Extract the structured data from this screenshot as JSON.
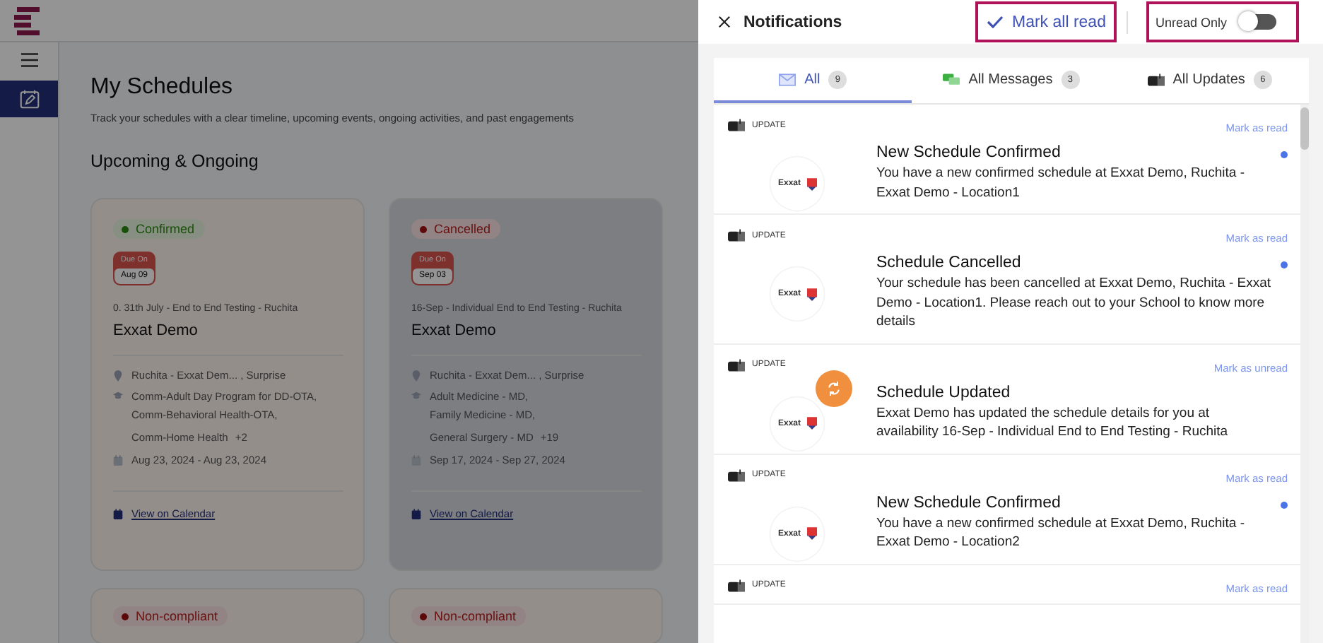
{
  "page": {
    "title": "My Schedules",
    "subtitle": "Track your schedules with a clear timeline, upcoming events, ongoing activities, and past engagements",
    "section": "Upcoming & Ongoing"
  },
  "cards": [
    {
      "status": {
        "label": "Confirmed",
        "kind": "confirmed"
      },
      "highlighted": false,
      "due_label": "Due On",
      "due_date": "Aug 09",
      "subtitle": "0. 31th July - End to End Testing - Ruchita",
      "title": "Exxat Demo",
      "location": "Ruchita - Exxat Dem...  , Surprise",
      "programs": [
        "Comm-Adult Day Program for DD-OTA,",
        "Comm-Behavioral Health-OTA,",
        "Comm-Home Health"
      ],
      "more": "+2",
      "dates": "Aug 23, 2024 - Aug 23, 2024",
      "link": "View on Calendar"
    },
    {
      "status": {
        "label": "Cancelled",
        "kind": "cancelled"
      },
      "highlighted": true,
      "due_label": "Due On",
      "due_date": "Sep 03",
      "subtitle": "16-Sep - Individual End to End Testing - Ruchita",
      "title": "Exxat Demo",
      "location": "Ruchita - Exxat Dem...  , Surprise",
      "programs": [
        "Adult Medicine - MD,",
        "Family Medicine - MD,",
        "General Surgery - MD"
      ],
      "more": "+19",
      "dates": "Sep 17, 2024 - Sep 27, 2024",
      "link": "View on Calendar"
    }
  ],
  "next_cards": [
    {
      "status": {
        "label": "Non-compliant",
        "kind": "noncompliant"
      }
    },
    {
      "status": {
        "label": "Non-compliant",
        "kind": "noncompliant"
      }
    }
  ],
  "panel": {
    "title": "Notifications",
    "mark_all": "Mark all read",
    "unread_only": {
      "label": "Unread Only",
      "on": false
    }
  },
  "tabs": [
    {
      "label": "All",
      "count": "9",
      "kind": "mail",
      "selected": true
    },
    {
      "label": "All Messages",
      "count": "3",
      "kind": "chat",
      "selected": false
    },
    {
      "label": "All Updates",
      "count": "6",
      "kind": "update",
      "selected": false
    }
  ],
  "notifications": [
    {
      "type": "UPDATE",
      "action": "Mark as read",
      "title": "New Schedule Confirmed",
      "body": "You have a new confirmed schedule at Exxat Demo, Ruchita - Exxat Demo - Location1",
      "logo": "Exxat",
      "unread": true,
      "badge": false
    },
    {
      "type": "UPDATE",
      "action": "Mark as read",
      "title": "Schedule Cancelled",
      "body": "Your schedule has been cancelled at Exxat Demo, Ruchita - Exxat Demo - Location1. Please reach out to your School to know more details",
      "logo": "Exxat",
      "unread": true,
      "badge": false
    },
    {
      "type": "UPDATE",
      "action": "Mark as unread",
      "title": "Schedule Updated",
      "body": "Exxat Demo has updated the schedule details for you at availability 16-Sep - Individual End to End Testing - Ruchita",
      "logo": "Exxat",
      "unread": false,
      "badge": true
    },
    {
      "type": "UPDATE",
      "action": "Mark as read",
      "title": "New Schedule Confirmed",
      "body": "You have a new confirmed schedule at Exxat Demo, Ruchita - Exxat Demo - Location2",
      "logo": "Exxat",
      "unread": true,
      "badge": false
    },
    {
      "type": "UPDATE",
      "action": "Mark as read"
    }
  ]
}
